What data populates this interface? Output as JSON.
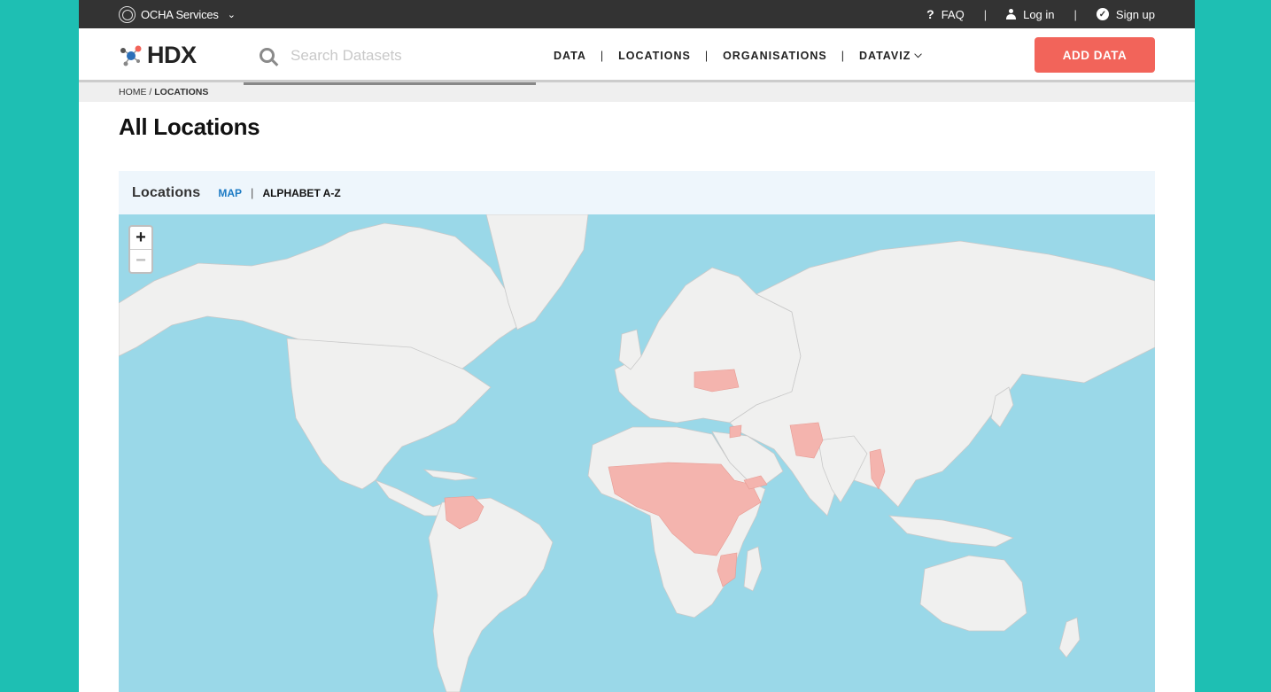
{
  "topbar": {
    "ocha_label": "OCHA Services",
    "faq": "FAQ",
    "login": "Log in",
    "signup": "Sign up",
    "separator": "|"
  },
  "header": {
    "logo_text": "HDX",
    "search_placeholder": "Search Datasets",
    "nav": [
      "DATA",
      "LOCATIONS",
      "ORGANISATIONS",
      "DATAVIZ"
    ],
    "nav_separator": "|",
    "add_button": "ADD DATA"
  },
  "breadcrumb": {
    "home": "HOME",
    "separator": " / ",
    "current": "LOCATIONS"
  },
  "page_title": "All Locations",
  "locations_panel": {
    "title": "Locations",
    "tabs": [
      "MAP",
      "ALPHABET A-Z"
    ],
    "tab_separator": "|",
    "active_tab": "MAP"
  },
  "map": {
    "zoom_in": "+",
    "zoom_out": "−",
    "ocean_color": "#9ad8e8",
    "land_color": "#f0f0ef",
    "highlight_color": "#f4b4ae"
  },
  "colors": {
    "background": "#1ebfb3",
    "topbar": "#333333",
    "accent_button": "#f2645a",
    "link_blue": "#1d7bc4"
  }
}
